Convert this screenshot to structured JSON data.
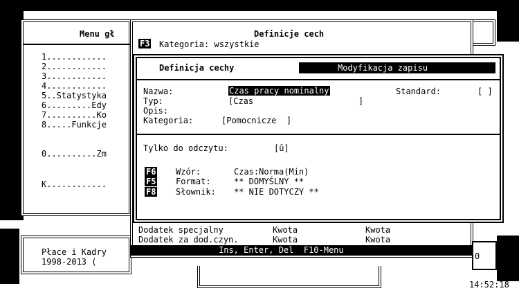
{
  "main_menu": {
    "title": "Menu gł",
    "items": [
      "1............",
      "2............",
      "3............",
      "4............",
      "5..Statystyka",
      "6.........Edy",
      "7..........Ko",
      "8.....Funkcje",
      "0..........Zm",
      "K............"
    ]
  },
  "footer_box": {
    "line1": "Płace i Kadry",
    "line2": "1998-2013 ("
  },
  "definitions": {
    "title": "Definicje cech",
    "category_key": "F3",
    "category_label": "Kategoria: wszystkie",
    "rows": [
      {
        "name": "Dodatek specjalny",
        "type": "Kwota",
        "type2": "Kwota"
      },
      {
        "name": "Dodatek za dod.czyn.",
        "type": "Kwota",
        "type2": "Kwota"
      }
    ],
    "status_line": "Ins, Enter, Del  F10-Menu"
  },
  "trait_dialog": {
    "title": "Definicja cechy",
    "mode": "Modyfikacja zapisu",
    "fields": {
      "name_label": "Nazwa:",
      "name_value": "Czas pracy nominalny",
      "standard_label": "Standard:",
      "standard_value": "[ ]",
      "type_label": "Typ:",
      "type_value": "[Czas                     ]",
      "desc_label": "Opis:",
      "category_label": "Kategoria:",
      "category_value": "[Pomocnicze  ]",
      "readonly_label": "Tylko do odczytu:",
      "readonly_value": "[û]"
    },
    "keys": [
      {
        "key": "F6",
        "label": "Wzór:   ",
        "value": "Czas:Norma(Min)"
      },
      {
        "key": "F5",
        "label": "Format: ",
        "value": "** DOMYŚLNY **"
      },
      {
        "key": "F8",
        "label": "Słownik:",
        "value": "** NIE DOTYCZY **"
      }
    ]
  },
  "right_fragment": "0",
  "clock": "14:52:18"
}
